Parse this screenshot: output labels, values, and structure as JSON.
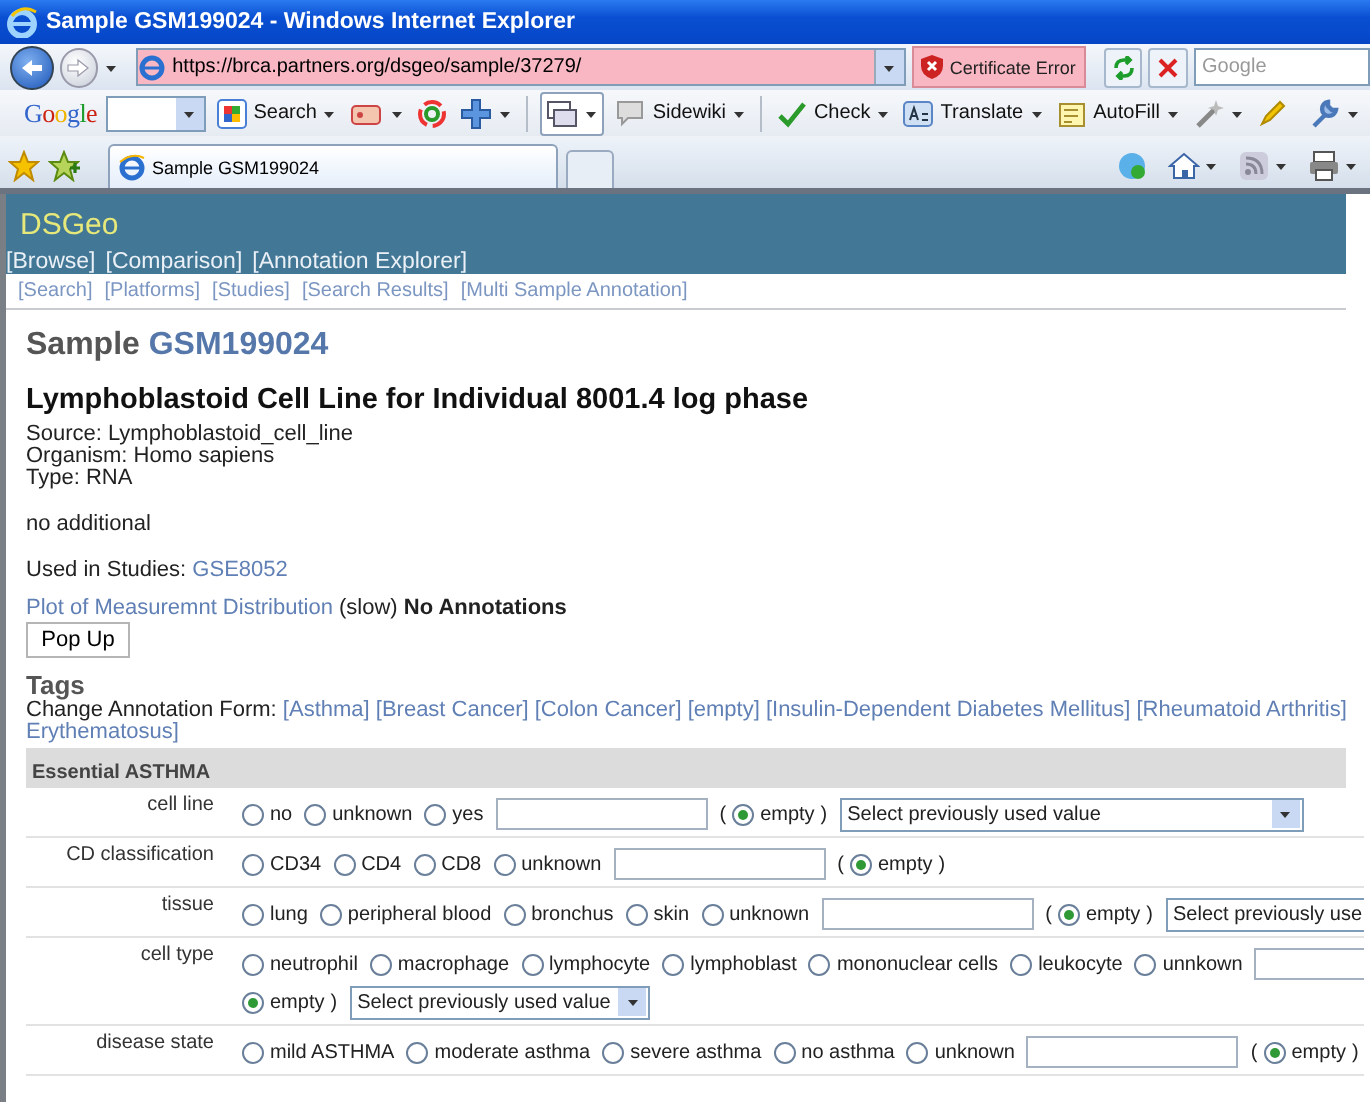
{
  "window": {
    "title": "Sample GSM199024 - Windows Internet Explorer"
  },
  "address_bar": {
    "url": "https://brca.partners.org/dsgeo/sample/37279/",
    "certificate": "Certificate Error",
    "search": {
      "placeholder": "Google"
    }
  },
  "toolbar": {
    "logo": "Google",
    "buttons": [
      {
        "label": "Search"
      },
      {
        "label": "Sidewiki"
      },
      {
        "label": "Check"
      },
      {
        "label": "Translate"
      },
      {
        "label": "AutoFill"
      }
    ]
  },
  "tabs": [
    {
      "label": "Sample GSM199024",
      "selected": true
    }
  ],
  "page": {
    "site_title": "DSGeo",
    "main_nav": [
      "[Browse]",
      "[Comparison]",
      "[Annotation Explorer]"
    ],
    "sub_nav": [
      "[Search]",
      "[Platforms]",
      "[Studies]",
      "[Search Results]",
      "[Multi Sample Annotation]"
    ],
    "heading": {
      "label": "Sample",
      "id": "GSM199024"
    },
    "title": "Lymphoblastoid Cell Line for Individual 8001.4 log phase",
    "details": [
      "Source: Lymphoblastoid_cell_line",
      "Organism: Homo sapiens",
      "Type: RNA"
    ],
    "note": "no additional",
    "studies": {
      "label": "Used in Studies:",
      "link": "GSE8052"
    },
    "plot": {
      "link": "Plot of Measuremnt Distribution",
      "speed": "(slow)",
      "status": "No Annotations",
      "button": "Pop Up"
    },
    "tags": {
      "title": "Tags",
      "label": "Change Annotation Form:",
      "forms": [
        "[Asthma]",
        "[Breast Cancer]",
        "[Colon Cancer]",
        "[empty]",
        "[Insulin-Dependent Diabetes Mellitus]",
        "[Rheumatoid Arthritis]",
        "Erythematosus]"
      ]
    },
    "annotation": {
      "section": "Essential ASTHMA",
      "fields": [
        {
          "label": "cell line",
          "kind": "single-line",
          "options": [
            {
              "label": "no",
              "selected": false
            },
            {
              "label": "unknown",
              "selected": false
            },
            {
              "label": "yes",
              "selected": false
            }
          ],
          "empty": {
            "open": "(",
            "label": "empty",
            "close": ")",
            "selected": true
          },
          "select": "Select previously used value"
        },
        {
          "label": "CD classification",
          "kind": "single-line",
          "options": [
            {
              "label": "CD34",
              "selected": false
            },
            {
              "label": "CD4",
              "selected": false
            },
            {
              "label": "CD8",
              "selected": false
            },
            {
              "label": "unknown",
              "selected": false
            }
          ],
          "empty": {
            "open": "(",
            "label": "empty",
            "close": ")",
            "selected": true
          }
        },
        {
          "label": "tissue",
          "kind": "single-line",
          "options": [
            {
              "label": "lung",
              "selected": false
            },
            {
              "label": "peripheral blood",
              "selected": false
            },
            {
              "label": "bronchus",
              "selected": false
            },
            {
              "label": "skin",
              "selected": false
            },
            {
              "label": "unknown",
              "selected": false
            }
          ],
          "empty": {
            "open": "(",
            "label": "empty",
            "close": ")",
            "selected": true
          },
          "select": "Select previously use"
        },
        {
          "label": "cell type",
          "kind": "wrapped",
          "options": [
            {
              "label": "neutrophil",
              "selected": false
            },
            {
              "label": "macrophage",
              "selected": false
            },
            {
              "label": "lymphocyte",
              "selected": false
            },
            {
              "label": "lymphoblast",
              "selected": false
            },
            {
              "label": "mononuclear cells",
              "selected": false
            },
            {
              "label": "leukocyte",
              "selected": false
            },
            {
              "label": "unnkown",
              "selected": false
            }
          ],
          "empty": {
            "label": "empty",
            "close": ")",
            "selected": true
          },
          "select": "Select previously used value"
        },
        {
          "label": "disease state",
          "kind": "single-line",
          "options": [
            {
              "label": "mild ASTHMA",
              "selected": false
            },
            {
              "label": "moderate asthma",
              "selected": false
            },
            {
              "label": "severe asthma",
              "selected": false
            },
            {
              "label": "no asthma",
              "selected": false
            },
            {
              "label": "unknown",
              "selected": false
            }
          ],
          "empty": {
            "open": "(",
            "label": "empty",
            "close": ")",
            "selected": true
          }
        }
      ]
    }
  }
}
